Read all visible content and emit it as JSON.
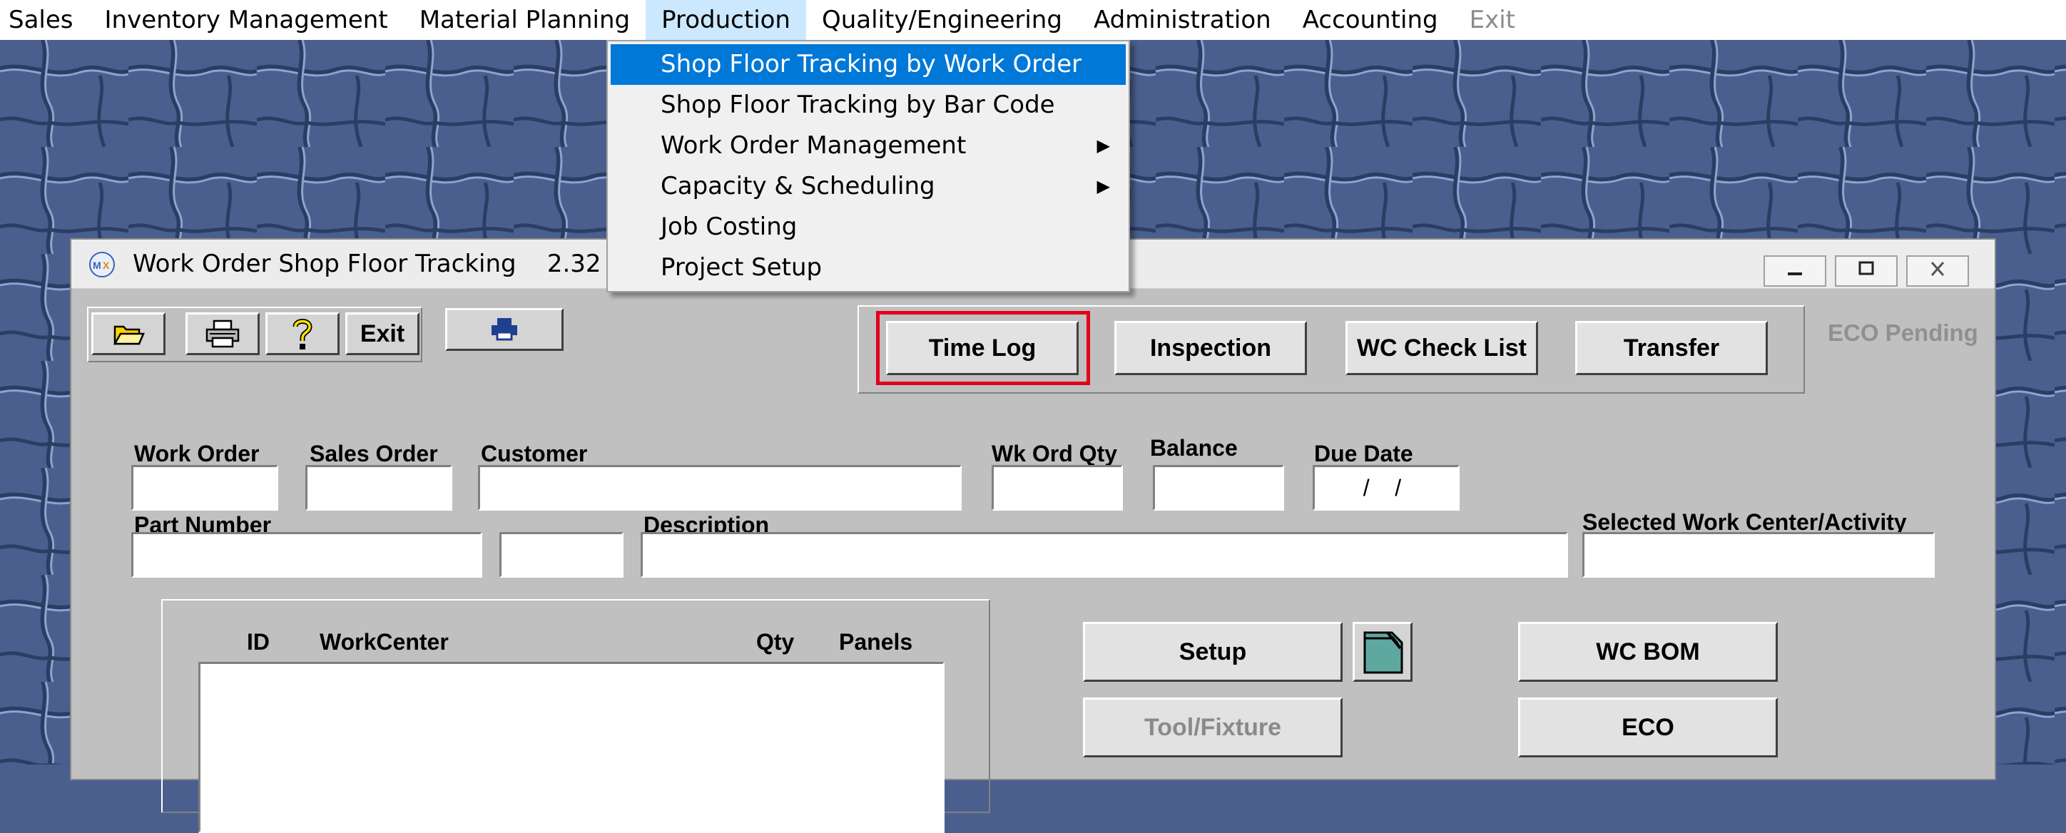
{
  "menubar": {
    "items": [
      {
        "label": "Sales"
      },
      {
        "label": "Inventory Management"
      },
      {
        "label": "Material Planning"
      },
      {
        "label": "Production"
      },
      {
        "label": "Quality/Engineering"
      },
      {
        "label": "Administration"
      },
      {
        "label": "Accounting"
      },
      {
        "label": "Exit"
      }
    ]
  },
  "production_menu": {
    "items": [
      {
        "label": "Shop Floor Tracking by Work Order"
      },
      {
        "label": "Shop Floor Tracking by Bar Code"
      },
      {
        "label": "Work Order Management"
      },
      {
        "label": "Capacity & Scheduling"
      },
      {
        "label": "Job Costing"
      },
      {
        "label": "Project Setup"
      }
    ]
  },
  "window": {
    "title": "Work Order Shop Floor Tracking    2.32"
  },
  "toolbar": {
    "exit_label": "Exit"
  },
  "actions": {
    "time_log": "Time Log",
    "inspection": "Inspection",
    "wc_check_list": "WC Check List",
    "transfer": "Transfer"
  },
  "eco_pending": "ECO Pending",
  "fields": {
    "work_order": {
      "label": "Work Order",
      "value": ""
    },
    "sales_order": {
      "label": "Sales Order",
      "value": ""
    },
    "customer": {
      "label": "Customer",
      "value": ""
    },
    "wk_ord_qty": {
      "label": "Wk Ord Qty",
      "value": ""
    },
    "balance": {
      "label": "Balance",
      "value": ""
    },
    "due_date": {
      "label": "Due Date",
      "value": "  /    /"
    },
    "part_number": {
      "label": "Part Number",
      "value": ""
    },
    "revision": {
      "value": ""
    },
    "description": {
      "label": "Description",
      "value": ""
    },
    "selected_wc": {
      "label": "Selected Work Center/Activity",
      "value": ""
    }
  },
  "list": {
    "columns": [
      "ID",
      "WorkCenter",
      "Qty",
      "Panels"
    ]
  },
  "buttons": {
    "setup": "Setup",
    "tool_fixture": "Tool/Fixture",
    "wc_bom": "WC BOM",
    "eco": "ECO"
  },
  "colors": {
    "menu_highlight": "#0078d7",
    "window_bg": "#c0c0c0",
    "desktop": "#4a5f8e",
    "time_log_outline": "#e4001b"
  }
}
